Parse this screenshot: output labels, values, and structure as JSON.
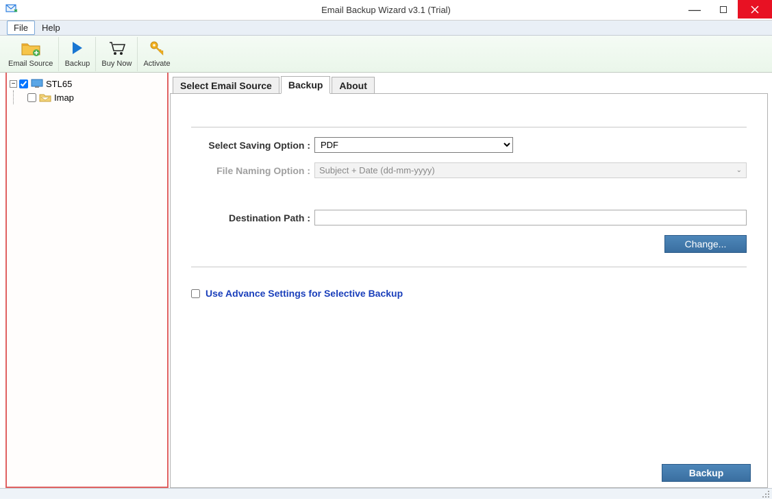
{
  "window": {
    "title": "Email Backup Wizard v3.1 (Trial)"
  },
  "menubar": {
    "items": [
      "File",
      "Help"
    ],
    "active_index": 0
  },
  "toolbar": {
    "items": [
      {
        "label": "Email Source",
        "icon": "folder-plus"
      },
      {
        "label": "Backup",
        "icon": "play"
      },
      {
        "label": "Buy Now",
        "icon": "cart"
      },
      {
        "label": "Activate",
        "icon": "key"
      }
    ]
  },
  "tree": {
    "root": {
      "label": "STL65",
      "checked": true,
      "expanded": true
    },
    "child": {
      "label": "Imap",
      "checked": false
    }
  },
  "tabs": {
    "items": [
      "Select Email Source",
      "Backup",
      "About"
    ],
    "active_index": 1
  },
  "form": {
    "saving_label": "Select Saving Option  :",
    "saving_value": "PDF",
    "naming_label": "File Naming Option  :",
    "naming_value": "Subject + Date (dd-mm-yyyy)",
    "dest_label": "Destination Path  :",
    "dest_value": "",
    "change_btn": "Change...",
    "advance_label": "Use Advance Settings for Selective Backup",
    "backup_btn": "Backup"
  }
}
